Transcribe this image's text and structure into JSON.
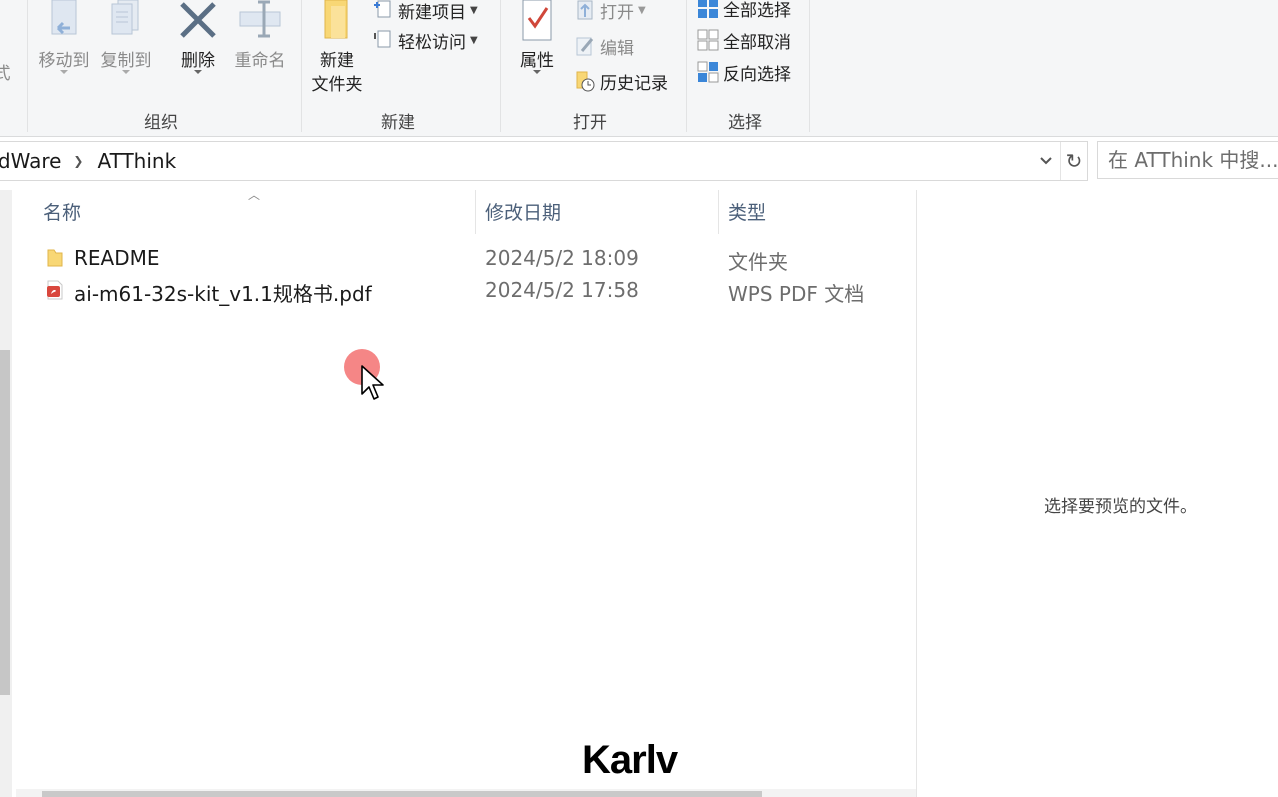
{
  "ribbon": {
    "partial_left_label": "式",
    "groups": {
      "organize": {
        "label": "组织",
        "move_to": "移动到",
        "copy_to": "复制到",
        "delete": "删除",
        "rename": "重命名"
      },
      "new": {
        "label": "新建",
        "new_folder_line1": "新建",
        "new_folder_line2": "文件夹",
        "new_item": "新建项目",
        "easy_access": "轻松访问"
      },
      "open": {
        "label": "打开",
        "properties": "属性",
        "open": "打开",
        "edit": "编辑",
        "history": "历史记录"
      },
      "select": {
        "label": "选择",
        "select_all": "全部选择",
        "select_none": "全部取消",
        "invert": "反向选择"
      }
    }
  },
  "address": {
    "crumbs": [
      "rdWare",
      "ATThink"
    ],
    "refresh_glyph": "↻",
    "dropdown_glyph": "⌄"
  },
  "search": {
    "placeholder": "在 ATThink 中搜..."
  },
  "filelist": {
    "columns": [
      "名称",
      "修改日期",
      "类型"
    ],
    "rows": [
      {
        "name": "README",
        "date": "2024/5/2 18:09",
        "type": "文件夹",
        "icon": "folder-icon"
      },
      {
        "name": "ai-m61-32s-kit_v1.1规格书.pdf",
        "date": "2024/5/2 17:58",
        "type": "WPS PDF 文档",
        "icon": "pdf-icon"
      }
    ]
  },
  "preview": {
    "empty_text": "选择要预览的文件。"
  },
  "watermark": "Karlv",
  "colors": {
    "ribbon_bg": "#f5f6f7",
    "header_text": "#4c607a",
    "click_indicator": "#f47f80"
  }
}
